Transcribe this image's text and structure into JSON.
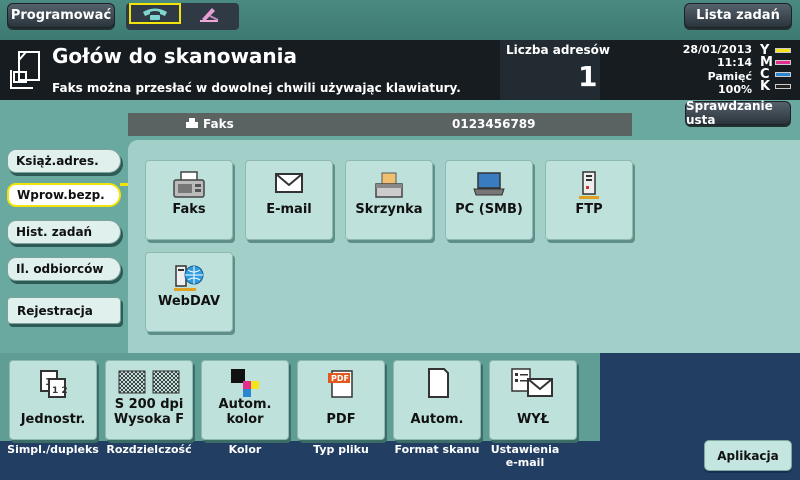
{
  "topbar": {
    "program_label": "Programować",
    "job_list_label": "Lista zadań"
  },
  "header": {
    "title": "Gołów do skanowania",
    "message": "Faks można przesłać w dowolnej chwili używając klawiatury.",
    "addr_count_label": "Liczba adresów",
    "addr_count_value": "1",
    "date": "28/01/2013",
    "time": "11:14",
    "memory_label": "Pamięć",
    "memory_value": "100%",
    "toner": [
      "Y",
      "M",
      "C",
      "K"
    ],
    "toner_colors": [
      "#f5e51a",
      "#e0308c",
      "#2a86d0",
      "#222222"
    ]
  },
  "check_settings_label": "Sprawdzanie usta",
  "fax_bar": {
    "label": "Faks",
    "number": "0123456789"
  },
  "side_tabs": [
    {
      "label": "Książ.adres."
    },
    {
      "label": "Wprow.bezp."
    },
    {
      "label": "Hist. zadań"
    },
    {
      "label": "Il. odbiorców"
    }
  ],
  "registration_label": "Rejestracja",
  "destinations": [
    {
      "label": "Faks",
      "icon": "fax-icon"
    },
    {
      "label": "E-mail",
      "icon": "envelope-icon"
    },
    {
      "label": "Skrzynka",
      "icon": "box-icon"
    },
    {
      "label": "PC (SMB)",
      "icon": "laptop-icon"
    },
    {
      "label": "FTP",
      "icon": "server-icon"
    },
    {
      "label": "WebDAV",
      "icon": "webdav-globe-icon"
    }
  ],
  "settings": [
    {
      "value": "Jednostr.",
      "label": "Simpl./dupleks"
    },
    {
      "value": "S 200 dpi\nWysoka F",
      "label": "Rozdzielczość"
    },
    {
      "value": "Autom. kolor",
      "label": "Kolor"
    },
    {
      "value": "PDF",
      "label": "Typ pliku"
    },
    {
      "value": "Autom.",
      "label": "Format skanu"
    },
    {
      "value": "WYŁ",
      "label": "Ustawienia e-mail"
    }
  ],
  "apply_label": "Aplikacja"
}
